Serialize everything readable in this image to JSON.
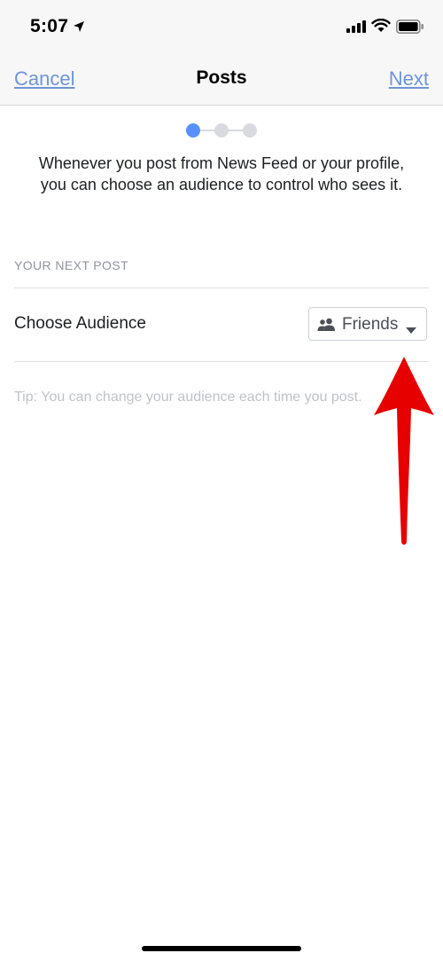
{
  "status_bar": {
    "time": "5:07",
    "icons": [
      "location-arrow-icon",
      "signal-bars-icon",
      "wifi-icon",
      "battery-icon"
    ]
  },
  "nav": {
    "cancel_label": "Cancel",
    "title": "Posts",
    "next_label": "Next"
  },
  "steps": {
    "total": 3,
    "current": 1,
    "active_color": "#5890ff",
    "inactive_color": "#d8dadf"
  },
  "intro_text": "Whenever you post from News Feed or your profile, you can choose an audience to control who sees it.",
  "section": {
    "header": "YOUR NEXT POST",
    "row_label": "Choose Audience",
    "audience": {
      "selected": "Friends",
      "icon": "friends-icon"
    },
    "tip": "Tip: You can change your audience each time you post."
  },
  "colors": {
    "link": "#6e95d9",
    "annotation_arrow": "#e60000"
  }
}
